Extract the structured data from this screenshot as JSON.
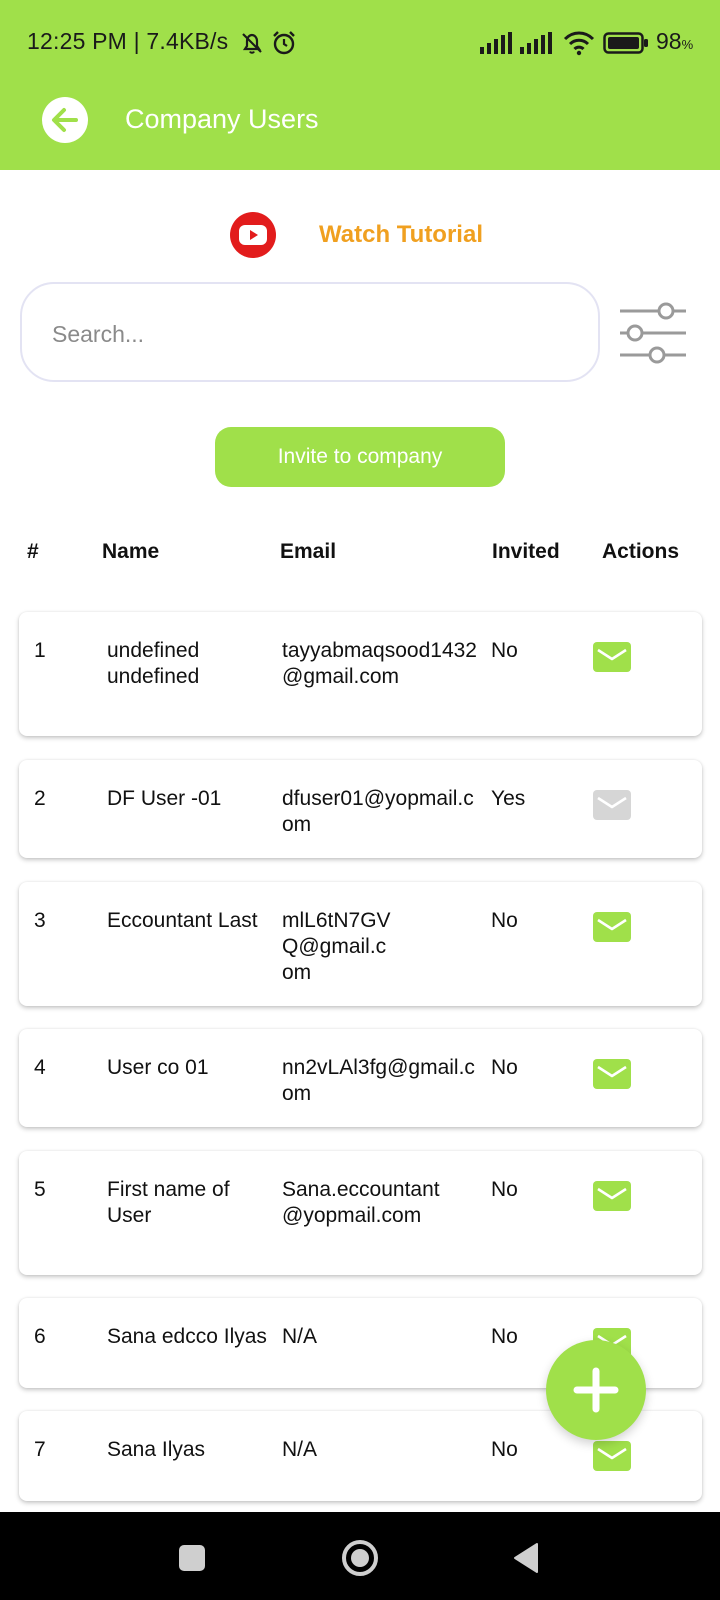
{
  "status_bar": {
    "time": "12:25 PM | 7.4KB/s",
    "battery": "98",
    "battery_unit": "%"
  },
  "header": {
    "title": "Company Users",
    "background": "#a0e04a"
  },
  "tutorial": {
    "label": "Watch Tutorial",
    "icon": "youtube-icon"
  },
  "search": {
    "placeholder": "Search...",
    "value": ""
  },
  "invite_button": {
    "label": "Invite to company"
  },
  "table": {
    "columns": [
      "#",
      "Name",
      "Email",
      "Invited",
      "Actions"
    ],
    "rows": [
      {
        "num": "1",
        "name": "undefined undefined",
        "email": "tayyabmaqsood1432@gmail.com",
        "invited": "No",
        "action_enabled": true
      },
      {
        "num": "2",
        "name": "DF User -01",
        "email": "dfuser01@yopmail.com",
        "invited": "Yes",
        "action_enabled": false
      },
      {
        "num": "3",
        "name": "Eccountant Last",
        "email": "mlL6tN7GVQ@gmail.com",
        "invited": "No",
        "action_enabled": true
      },
      {
        "num": "4",
        "name": "User co 01",
        "email": "nn2vLAl3fg@gmail.com",
        "invited": "No",
        "action_enabled": true
      },
      {
        "num": "5",
        "name": "First name of User",
        "email": "Sana.eccountant@yopmail.com",
        "invited": "No",
        "action_enabled": true
      },
      {
        "num": "6",
        "name": "Sana edcco Ilyas",
        "email": "N/A",
        "invited": "No",
        "action_enabled": true
      },
      {
        "num": "7",
        "name": "Sana Ilyas",
        "email": "N/A",
        "invited": "No",
        "action_enabled": true
      }
    ]
  },
  "colors": {
    "accent": "#a0e04a",
    "tutorial_text": "#f0a020",
    "youtube_red": "#e21c1c",
    "action_disabled": "#d6d6d6"
  },
  "icons": {
    "action": "mail-icon",
    "fab": "plus-icon",
    "back": "arrow-left-icon",
    "filter": "sliders-icon"
  }
}
